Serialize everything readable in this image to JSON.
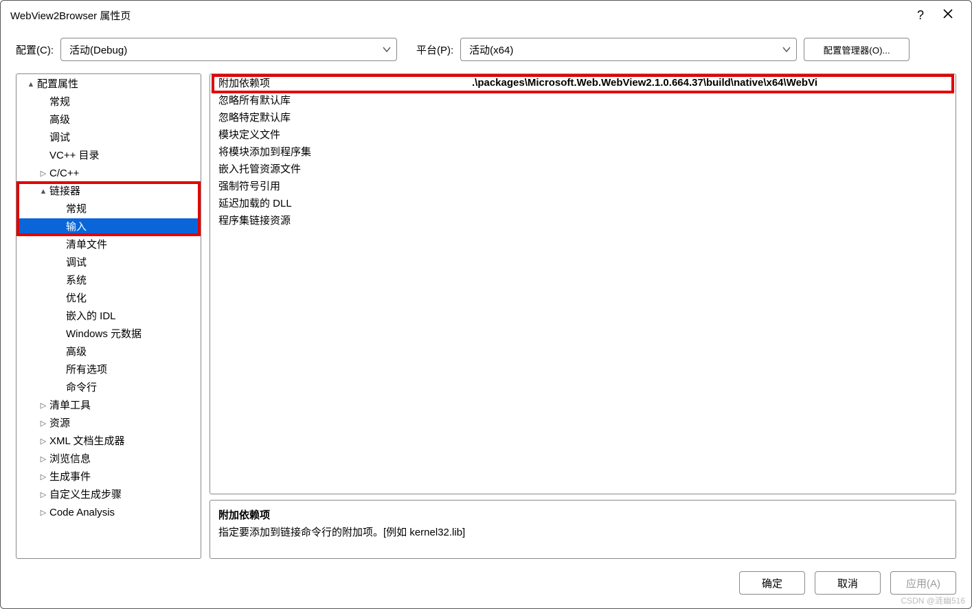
{
  "window": {
    "title": "WebView2Browser 属性页",
    "help": "?",
    "close": "×"
  },
  "config_row": {
    "config_label": "配置(C):",
    "config_value": "活动(Debug)",
    "platform_label": "平台(P):",
    "platform_value": "活动(x64)",
    "config_mgr_btn": "配置管理器(O)..."
  },
  "tree": {
    "items": [
      {
        "label": "配置属性",
        "level": 0,
        "expand": "▲"
      },
      {
        "label": "常规",
        "level": 1,
        "expand": ""
      },
      {
        "label": "高级",
        "level": 1,
        "expand": ""
      },
      {
        "label": "调试",
        "level": 1,
        "expand": ""
      },
      {
        "label": "VC++ 目录",
        "level": 1,
        "expand": ""
      },
      {
        "label": "C/C++",
        "level": 1,
        "expand": "▷"
      },
      {
        "label": "链接器",
        "level": 1,
        "expand": "▲"
      },
      {
        "label": "常规",
        "level": 2,
        "expand": ""
      },
      {
        "label": "输入",
        "level": 2,
        "expand": "",
        "selected": true
      },
      {
        "label": "清单文件",
        "level": 2,
        "expand": ""
      },
      {
        "label": "调试",
        "level": 2,
        "expand": ""
      },
      {
        "label": "系统",
        "level": 2,
        "expand": ""
      },
      {
        "label": "优化",
        "level": 2,
        "expand": ""
      },
      {
        "label": "嵌入的 IDL",
        "level": 2,
        "expand": ""
      },
      {
        "label": "Windows 元数据",
        "level": 2,
        "expand": ""
      },
      {
        "label": "高级",
        "level": 2,
        "expand": ""
      },
      {
        "label": "所有选项",
        "level": 2,
        "expand": ""
      },
      {
        "label": "命令行",
        "level": 2,
        "expand": ""
      },
      {
        "label": "清单工具",
        "level": 1,
        "expand": "▷"
      },
      {
        "label": "资源",
        "level": 1,
        "expand": "▷"
      },
      {
        "label": "XML 文档生成器",
        "level": 1,
        "expand": "▷"
      },
      {
        "label": "浏览信息",
        "level": 1,
        "expand": "▷"
      },
      {
        "label": "生成事件",
        "level": 1,
        "expand": "▷"
      },
      {
        "label": "自定义生成步骤",
        "level": 1,
        "expand": "▷"
      },
      {
        "label": "Code Analysis",
        "level": 1,
        "expand": "▷"
      }
    ]
  },
  "grid": {
    "rows": [
      {
        "label": "附加依赖项",
        "value": ".\\packages\\Microsoft.Web.WebView2.1.0.664.37\\build\\native\\x64\\WebVi"
      },
      {
        "label": "忽略所有默认库",
        "value": ""
      },
      {
        "label": "忽略特定默认库",
        "value": ""
      },
      {
        "label": "模块定义文件",
        "value": ""
      },
      {
        "label": "将模块添加到程序集",
        "value": ""
      },
      {
        "label": "嵌入托管资源文件",
        "value": ""
      },
      {
        "label": "强制符号引用",
        "value": ""
      },
      {
        "label": "延迟加载的 DLL",
        "value": ""
      },
      {
        "label": "程序集链接资源",
        "value": ""
      }
    ]
  },
  "description": {
    "title": "附加依赖项",
    "body": "指定要添加到链接命令行的附加项。[例如 kernel32.lib]"
  },
  "footer": {
    "ok": "确定",
    "cancel": "取消",
    "apply": "应用(A)"
  },
  "watermark": "CSDN @涟幽516"
}
